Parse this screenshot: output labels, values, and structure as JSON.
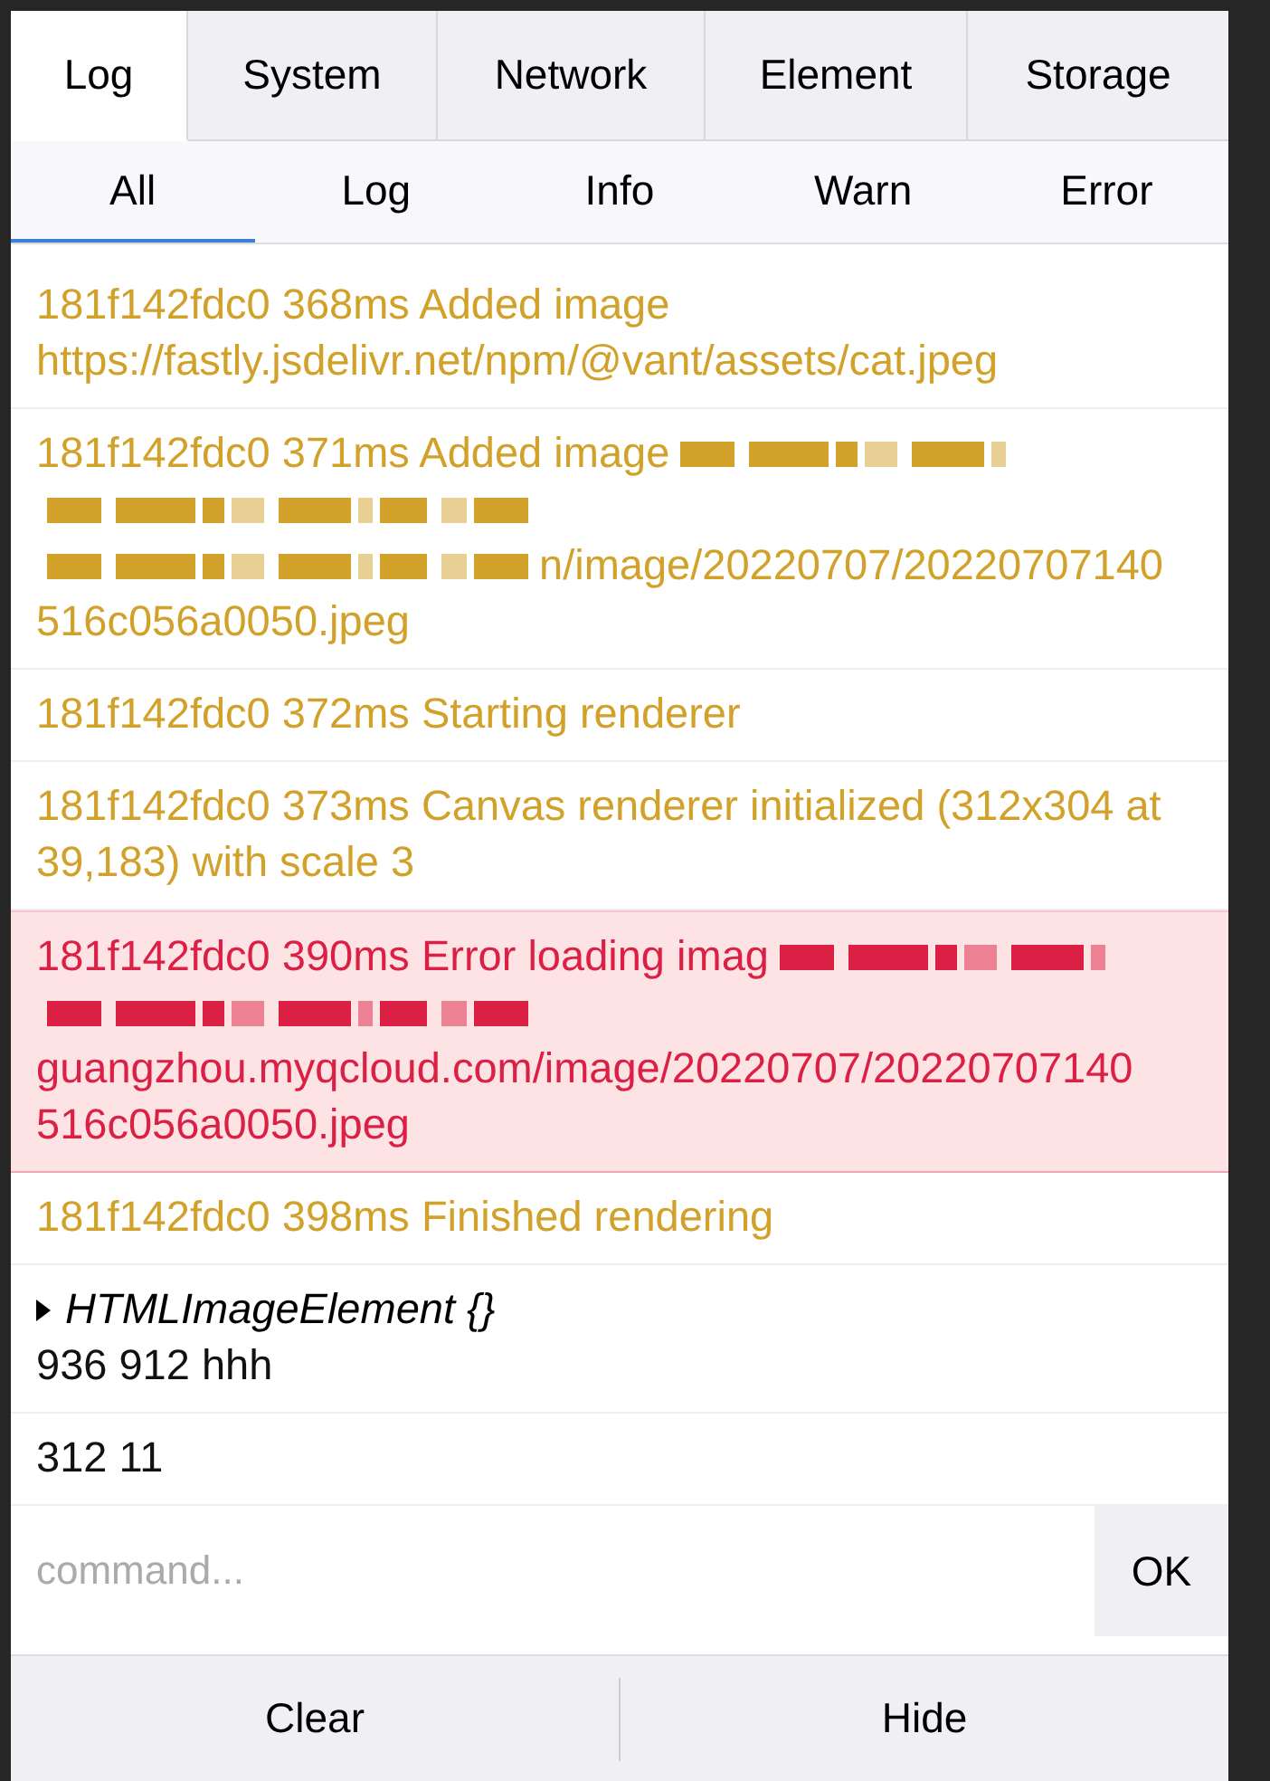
{
  "tabs": [
    {
      "label": "Log",
      "selected": true
    },
    {
      "label": "System",
      "selected": false
    },
    {
      "label": "Network",
      "selected": false
    },
    {
      "label": "Element",
      "selected": false
    },
    {
      "label": "Storage",
      "selected": false
    }
  ],
  "filters": [
    {
      "label": "All",
      "selected": true
    },
    {
      "label": "Log",
      "selected": false
    },
    {
      "label": "Info",
      "selected": false
    },
    {
      "label": "Warn",
      "selected": false
    },
    {
      "label": "Error",
      "selected": false
    }
  ],
  "logs": [
    {
      "kind": "warn",
      "lines": [
        {
          "text": "181f142fdc0 368ms Added image"
        },
        {
          "text": "https://fastly.jsdelivr.net/npm/@vant/assets/cat.jpeg"
        }
      ]
    },
    {
      "kind": "warn",
      "lines": [
        {
          "text": "181f142fdc0 371ms Added image",
          "redacted_end": true
        },
        {
          "redacted_start": true
        },
        {
          "text": "n/image/20220707/20220707140",
          "redacted_start": true
        },
        {
          "text": "516c056a0050.jpeg"
        }
      ]
    },
    {
      "kind": "warn",
      "lines": [
        {
          "text": "181f142fdc0 372ms Starting renderer"
        }
      ]
    },
    {
      "kind": "warn",
      "lines": [
        {
          "text": "181f142fdc0 373ms Canvas renderer initialized (312x304 at 39,183) with scale 3"
        }
      ]
    },
    {
      "kind": "error",
      "lines": [
        {
          "text": "181f142fdc0 390ms Error loading imag",
          "redacted_end": true
        },
        {
          "redacted_start": true
        },
        {
          "text": "guangzhou.myqcloud.com/image/20220707/20220707140"
        },
        {
          "text": "516c056a0050.jpeg"
        }
      ]
    },
    {
      "kind": "warn",
      "lines": [
        {
          "text": "181f142fdc0 398ms Finished rendering"
        }
      ]
    },
    {
      "kind": "object",
      "object": {
        "label": "HTMLImageElement {}",
        "expanded": false
      },
      "lines": [
        {
          "text": "936 912 hhh"
        }
      ]
    },
    {
      "kind": "log",
      "lines": [
        {
          "text": "312 11"
        }
      ]
    }
  ],
  "command": {
    "placeholder": "command...",
    "button": "OK"
  },
  "footer": [
    "Clear",
    "Hide"
  ]
}
